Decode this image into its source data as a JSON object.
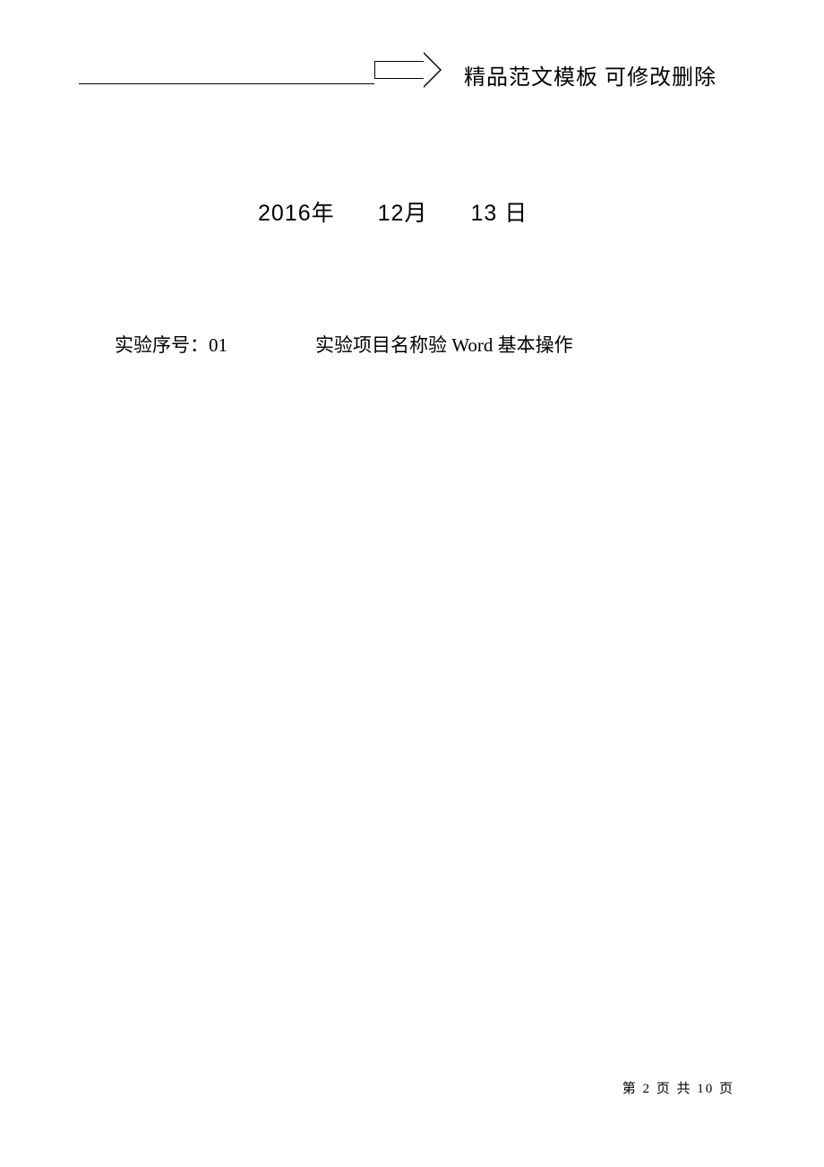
{
  "header": {
    "text": "精品范文模板  可修改删除"
  },
  "date": {
    "year": "2016",
    "year_suffix": "年",
    "month": "12",
    "month_suffix": "月",
    "day": "13",
    "day_suffix": "日"
  },
  "experiment": {
    "serial_label": "实验序号：",
    "serial_value": "01",
    "project_label": "实验项目名称验 Word 基本操作"
  },
  "footer": {
    "prefix": "第",
    "current_page": "2",
    "middle": "页 共",
    "total_pages": "10",
    "suffix": "页"
  }
}
